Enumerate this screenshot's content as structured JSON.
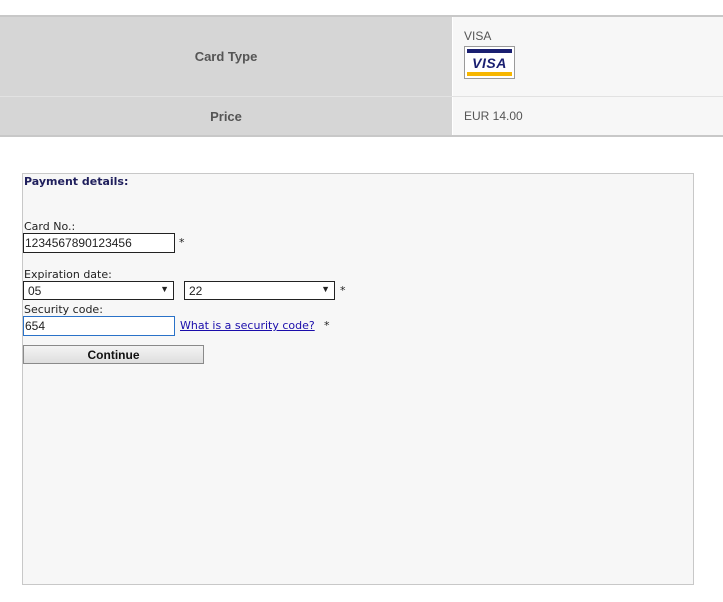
{
  "summary": {
    "card_type_label": "Card Type",
    "card_type_value": "VISA",
    "card_logo_text": "VISA",
    "price_label": "Price",
    "price_value": "EUR 14.00"
  },
  "payment": {
    "title": "Payment details:",
    "card_no_label": "Card No.:",
    "card_no_value": "1234567890123456",
    "expiration_label": "Expiration date:",
    "expiration_month": "05",
    "expiration_year": "22",
    "security_label": "Security code:",
    "security_value": "654",
    "security_help_link": "What is a security code?",
    "required_marker": "*",
    "continue_label": "Continue"
  },
  "colors": {
    "visa_blue": "#1a1f71",
    "visa_gold": "#f7b600",
    "link": "#1a0dab",
    "focus_border": "#2a72c8"
  },
  "icons": {
    "select_arrow": "dropdown-arrow-icon",
    "card_logo": "visa-logo-icon"
  }
}
